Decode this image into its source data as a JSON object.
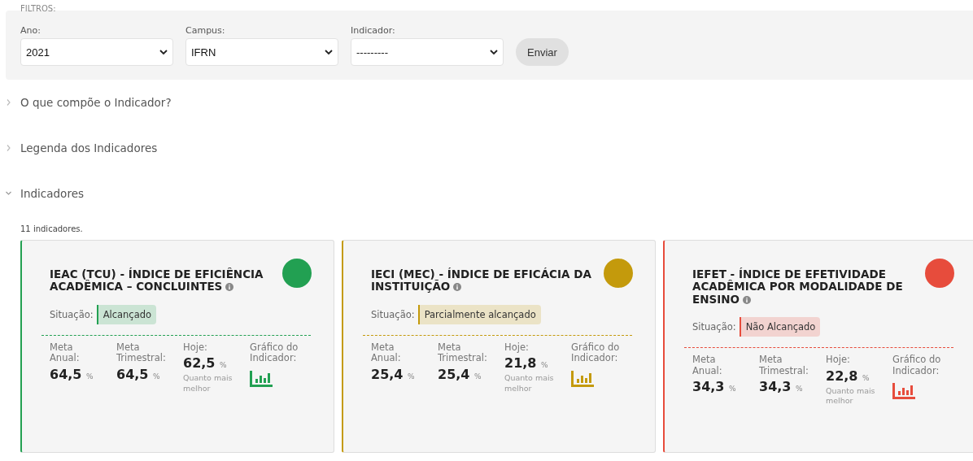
{
  "filters": {
    "legend": "FILTROS:",
    "fields": [
      {
        "label": "Ano:",
        "value": "2021"
      },
      {
        "label": "Campus:",
        "value": "IFRN"
      },
      {
        "label": "Indicador:",
        "value": "---------"
      }
    ],
    "submit": "Enviar"
  },
  "sections": [
    {
      "title": "O que compõe o Indicador?",
      "expanded": false
    },
    {
      "title": "Legenda dos Indicadores",
      "expanded": false
    },
    {
      "title": "Indicadores",
      "expanded": true
    }
  ],
  "count": "11 indicadores.",
  "cards": [
    {
      "title": "IEAC (TCU) - ÍNDICE DE EFICIÊNCIA ACADÊMICA – CONCLUINTES",
      "color": "#22a052",
      "situation_label": "Situação:",
      "situation": "Alcançado",
      "metrics": [
        {
          "label": "Meta Anual:",
          "value": "64,5",
          "unit": "%"
        },
        {
          "label": "Meta Trimestral:",
          "value": "64,5",
          "unit": "%"
        },
        {
          "label": "Hoje:",
          "value": "62,5",
          "unit": "%",
          "note": "Quanto mais melhor"
        }
      ],
      "chart_label": "Gráfico do Indicador:"
    },
    {
      "title": "IECI (MEC) - ÍNDICE DE EFICÁCIA DA INSTITUIÇÃO",
      "color": "#c49a0c",
      "situation_label": "Situação:",
      "situation": "Parcialmente alcançado",
      "metrics": [
        {
          "label": "Meta Anual:",
          "value": "25,4",
          "unit": "%"
        },
        {
          "label": "Meta Trimestral:",
          "value": "25,4",
          "unit": "%"
        },
        {
          "label": "Hoje:",
          "value": "21,8",
          "unit": "%",
          "note": "Quanto mais melhor"
        }
      ],
      "chart_label": "Gráfico do Indicador:"
    },
    {
      "title": "IEFET - ÍNDICE DE EFETIVIDADE ACADÊMICA POR MODALIDADE DE ENSINO",
      "color": "#e74c3c",
      "situation_label": "Situação:",
      "situation": "Não Alcançado",
      "metrics": [
        {
          "label": "Meta Anual:",
          "value": "34,3",
          "unit": "%"
        },
        {
          "label": "Meta Trimestral:",
          "value": "34,3",
          "unit": "%"
        },
        {
          "label": "Hoje:",
          "value": "22,8",
          "unit": "%",
          "note": "Quanto mais melhor"
        }
      ],
      "chart_label": "Gráfico do Indicador:"
    }
  ]
}
